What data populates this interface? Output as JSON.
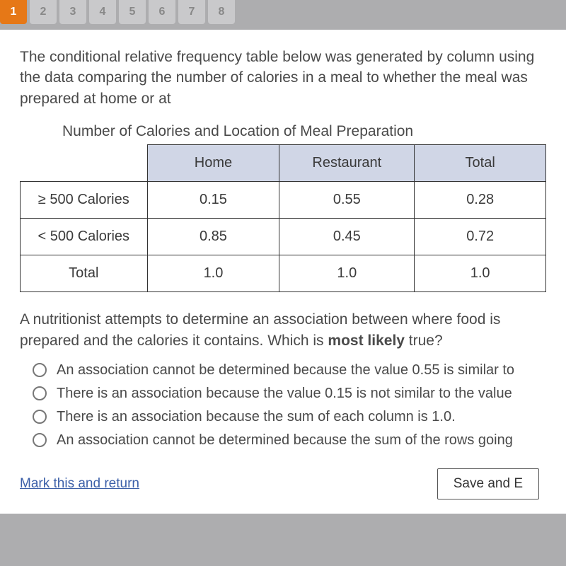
{
  "nav": {
    "tabs": [
      "1",
      "2",
      "3",
      "4",
      "5",
      "6",
      "7",
      "8"
    ],
    "active_index": 0
  },
  "intro": "The conditional relative frequency table below was generated by column using the data comparing the number of calories in a meal to whether the meal was prepared at home or at",
  "table": {
    "title": "Number of Calories and Location of Meal Preparation",
    "col_headers": [
      "Home",
      "Restaurant",
      "Total"
    ],
    "rows": [
      {
        "label": "≥ 500 Calories",
        "cells": [
          "0.15",
          "0.55",
          "0.28"
        ]
      },
      {
        "label": "< 500 Calories",
        "cells": [
          "0.85",
          "0.45",
          "0.72"
        ]
      },
      {
        "label": "Total",
        "cells": [
          "1.0",
          "1.0",
          "1.0"
        ]
      }
    ]
  },
  "question_pre": "A nutritionist attempts to determine an association between where food is prepared and the calories it contains. Which is ",
  "question_bold": "most likely",
  "question_post": " true?",
  "options": [
    "An association cannot be determined because the value 0.55 is similar to",
    "There is an association because the value 0.15 is not similar to the value",
    "There is an association because the sum of each column is 1.0.",
    "An association cannot be determined because the sum of the rows going"
  ],
  "footer": {
    "mark": "Mark this and return",
    "save": "Save and E"
  },
  "chart_data": {
    "type": "table",
    "title": "Number of Calories and Location of Meal Preparation",
    "columns": [
      "Home",
      "Restaurant",
      "Total"
    ],
    "rows": [
      "≥ 500 Calories",
      "< 500 Calories",
      "Total"
    ],
    "values": [
      [
        0.15,
        0.55,
        0.28
      ],
      [
        0.85,
        0.45,
        0.72
      ],
      [
        1.0,
        1.0,
        1.0
      ]
    ]
  }
}
